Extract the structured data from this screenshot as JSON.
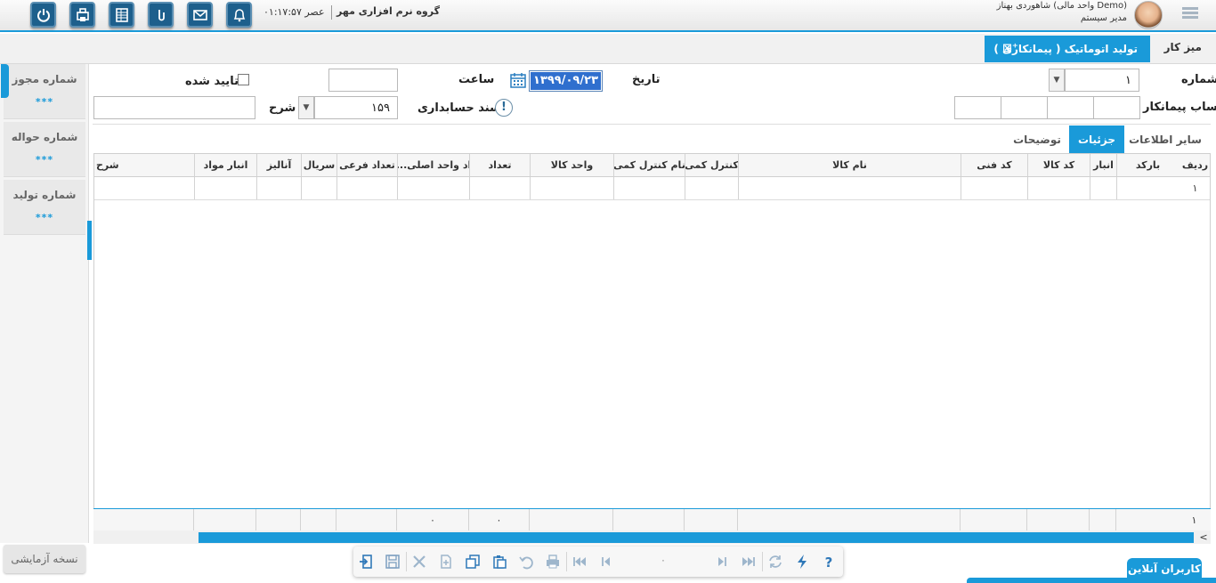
{
  "topbar": {
    "clock": "۰۱:۱۷:۵۷ عصر",
    "company": "گروه نرم افزاری مهر",
    "user_name": "شاهوردی بهناز (واحد مالی Demo)",
    "user_role": "مدیر سیستم",
    "icons": [
      "power-icon",
      "print-queue-icon",
      "spreadsheet-icon",
      "attachment-icon",
      "mail-icon",
      "bell-icon"
    ]
  },
  "tabs": {
    "desk": "میز کار",
    "active": "تولید اتوماتیک ( پیمانکاری )",
    "close": "⊠⁺"
  },
  "sidebar": {
    "items": [
      {
        "label": "شماره مجوز",
        "value": "***"
      },
      {
        "label": "شماره حواله",
        "value": "***"
      },
      {
        "label": "شماره تولید",
        "value": "***"
      }
    ],
    "trial": "نسخه آزمایشی"
  },
  "form": {
    "number_label": "شماره",
    "number_value": "۱",
    "date_label": "تاریخ",
    "date_value": "۱۳۹۹/۰۹/۲۳",
    "time_label": "ساعت",
    "time_value": "",
    "approved_label": "تایید شده",
    "contractor_label": "حساب پیمانکار",
    "voucher_label": "سند حسابداری",
    "desc_value": "۱۵۹",
    "desc_label": "شرح"
  },
  "detail_tabs": [
    "سایر اطلاعات",
    "جزئیات",
    "توضیحات"
  ],
  "grid": {
    "headers": [
      "ردیف",
      "بارکد",
      "انبار",
      "کد کالا",
      "کد فنی",
      "نام کالا",
      "کنترل کمی",
      "نام کنترل کمی",
      "واحد کالا",
      "تعداد",
      "...اد واحد اصلی",
      "تعداد فرعی",
      "سریال",
      "آنالیز",
      "انبار مواد",
      "شرح"
    ],
    "rows": [
      [
        "۱",
        "",
        "",
        "",
        "",
        "",
        "",
        "",
        "",
        "",
        "",
        "",
        "",
        "",
        "",
        ""
      ]
    ],
    "footer": [
      "۱",
      "",
      "",
      "",
      "",
      "",
      "",
      "",
      "",
      "۰",
      "۰",
      "",
      "",
      "",
      "",
      ""
    ]
  },
  "toolbar": {
    "counter": "۰",
    "icons": [
      "exit-icon",
      "save-icon",
      "delete-icon",
      "new-icon",
      "copy-icon",
      "paste-icon",
      "undo-icon",
      "print-icon",
      "first-record-icon",
      "previous-record-icon",
      "next-record-icon",
      "last-record-icon",
      "refresh-icon",
      "quick-action-icon",
      "help-icon"
    ]
  },
  "online_users": "کاربران آنلاین"
}
